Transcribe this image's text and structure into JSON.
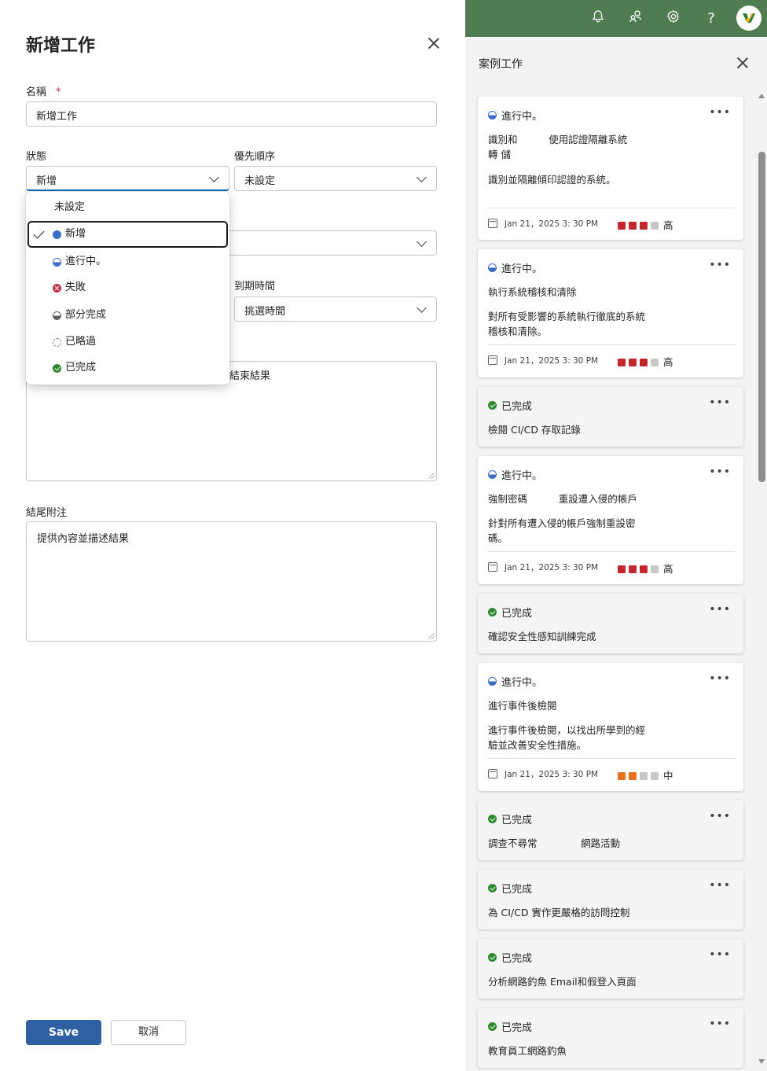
{
  "left": {
    "title": "新增工作",
    "name_label": "名稱",
    "required_mark": "*",
    "name_value": "新增工作",
    "status_label": "狀態",
    "status_value": "新增",
    "priority_label": "優先順序",
    "priority_value": "未設定",
    "due_time_label": "到期時間",
    "due_time_value": "挑選時間",
    "description_partial": "結束結果",
    "closing_notes_label": "結尾附注",
    "closing_notes_value": "提供內容並描述結果",
    "save_label": "Save",
    "cancel_label": "取消",
    "status_options": [
      {
        "label": "未設定",
        "icon": "none"
      },
      {
        "label": "新增",
        "icon": "new-status-icon",
        "selected": true
      },
      {
        "label": "進行中。",
        "icon": "in-progress-icon"
      },
      {
        "label": "失敗",
        "icon": "failed-icon"
      },
      {
        "label": "部分完成",
        "icon": "partially-completed-icon"
      },
      {
        "label": "已略過",
        "icon": "skipped-icon"
      },
      {
        "label": "已完成",
        "icon": "completed-icon"
      }
    ]
  },
  "right": {
    "topbar_color": "#4f7c50",
    "topbar_icons": [
      "bell-icon",
      "people-icon",
      "gear-icon",
      "help-icon",
      "avatar"
    ],
    "pane_title": "案例工作",
    "date_text": "Jan 21，2025 3: 30 PM",
    "cards": [
      {
        "status": "進行中。",
        "title": "識別和          使用認證隔離系統\n轉 儲",
        "desc": "識別並隔離傾印認證的系統。",
        "date": true,
        "priority": "高",
        "priority_level": 3,
        "priority_color": "#c4262e"
      },
      {
        "status": "進行中。",
        "title": "執行系統稽核和清除",
        "desc": "對所有受影響的系統執行徹底的系統稽核和清除。",
        "date": true,
        "priority": "高",
        "priority_level": 3,
        "priority_color": "#c4262e"
      },
      {
        "status": "已完成",
        "title": "檢閱 CI/CD 存取記錄",
        "done": true
      },
      {
        "status": "進行中。",
        "title": "強制密碼          重設遭入侵的帳戶",
        "desc": "針對所有遭入侵的帳戶強制重設密碼。",
        "date": true,
        "priority": "高",
        "priority_level": 3,
        "priority_color": "#c4262e"
      },
      {
        "status": "已完成",
        "title": "確認安全性感知訓練完成",
        "done": true
      },
      {
        "status": "進行中。",
        "title": "進行事件後檢閱",
        "desc": "進行事件後檢閱，以找出所學到的經驗並改善安全性措施。",
        "date": true,
        "priority": "中",
        "priority_level": 2,
        "priority_color": "#e8711e"
      },
      {
        "status": "已完成",
        "title": "調查不尋常              網路活動",
        "done": true
      },
      {
        "status": "已完成",
        "title": "為 CI/CD 實作更嚴格的訪問控制",
        "done": true
      },
      {
        "status": "已完成",
        "title": "分析網路釣魚 Email和假登入頁面",
        "done": true
      },
      {
        "status": "已完成",
        "title": "教育員工網路釣魚",
        "done": true
      }
    ]
  }
}
